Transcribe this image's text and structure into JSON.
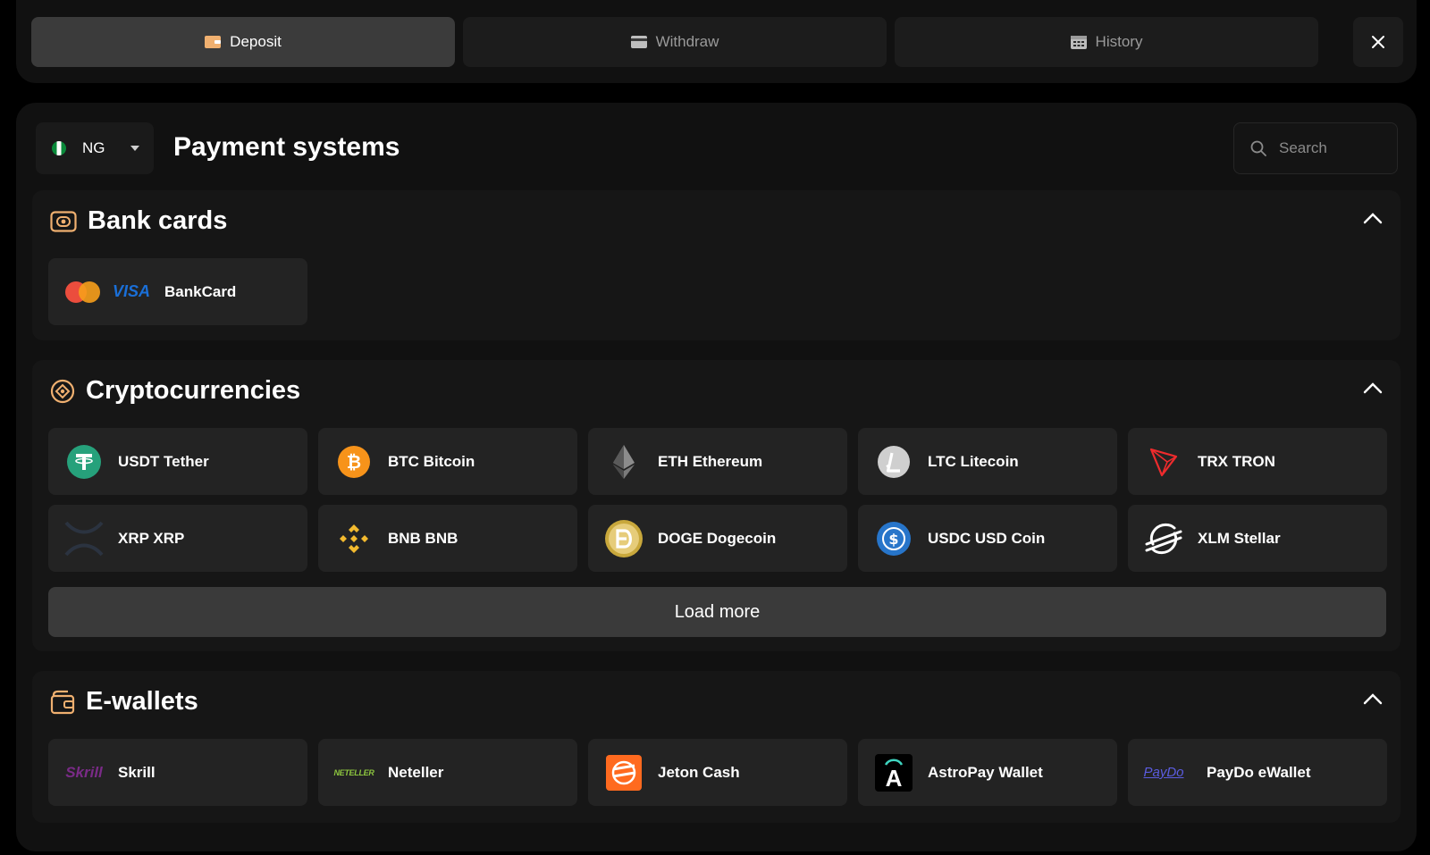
{
  "tabs": [
    {
      "label": "Deposit",
      "icon": "wallet-icon",
      "active": true
    },
    {
      "label": "Withdraw",
      "icon": "card-icon",
      "active": false
    },
    {
      "label": "History",
      "icon": "calendar-icon",
      "active": false
    }
  ],
  "country": {
    "code": "NG"
  },
  "page_title": "Payment systems",
  "search": {
    "placeholder": "Search"
  },
  "sections": {
    "bank_cards": {
      "title": "Bank cards",
      "items": [
        {
          "label": "BankCard",
          "icon": "mastercard-visa-icon"
        }
      ]
    },
    "crypto": {
      "title": "Cryptocurrencies",
      "items": [
        {
          "label": "USDT Tether",
          "icon": "tether-icon"
        },
        {
          "label": "BTC Bitcoin",
          "icon": "bitcoin-icon"
        },
        {
          "label": "ETH Ethereum",
          "icon": "ethereum-icon"
        },
        {
          "label": "LTC Litecoin",
          "icon": "litecoin-icon"
        },
        {
          "label": "TRX TRON",
          "icon": "tron-icon"
        },
        {
          "label": "XRP XRP",
          "icon": "xrp-icon"
        },
        {
          "label": "BNB BNB",
          "icon": "bnb-icon"
        },
        {
          "label": "DOGE Dogecoin",
          "icon": "dogecoin-icon"
        },
        {
          "label": "USDC USD Coin",
          "icon": "usdc-icon"
        },
        {
          "label": "XLM Stellar",
          "icon": "stellar-icon"
        }
      ],
      "load_more": "Load more"
    },
    "ewallets": {
      "title": "E-wallets",
      "items": [
        {
          "label": "Skrill",
          "icon": "skrill-icon",
          "logo_text": "Skrill"
        },
        {
          "label": "Neteller",
          "icon": "neteller-icon",
          "logo_text": "NETELLER"
        },
        {
          "label": "Jeton Cash",
          "icon": "jeton-icon"
        },
        {
          "label": "AstroPay Wallet",
          "icon": "astropay-icon",
          "logo_text": "A"
        },
        {
          "label": "PayDo eWallet",
          "icon": "paydo-icon",
          "logo_text": "PayDo"
        }
      ]
    }
  },
  "brand_text": {
    "visa": "VISA"
  },
  "colors": {
    "accent_orange": "#f0b070",
    "tether": "#26a17b",
    "bitcoin": "#f7931a",
    "tron": "#ef2b2d",
    "bnb": "#f3ba2f",
    "usdc": "#2775ca",
    "skrill": "#7a2b87",
    "neteller": "#8dc63f",
    "jeton": "#ff6a1f"
  }
}
